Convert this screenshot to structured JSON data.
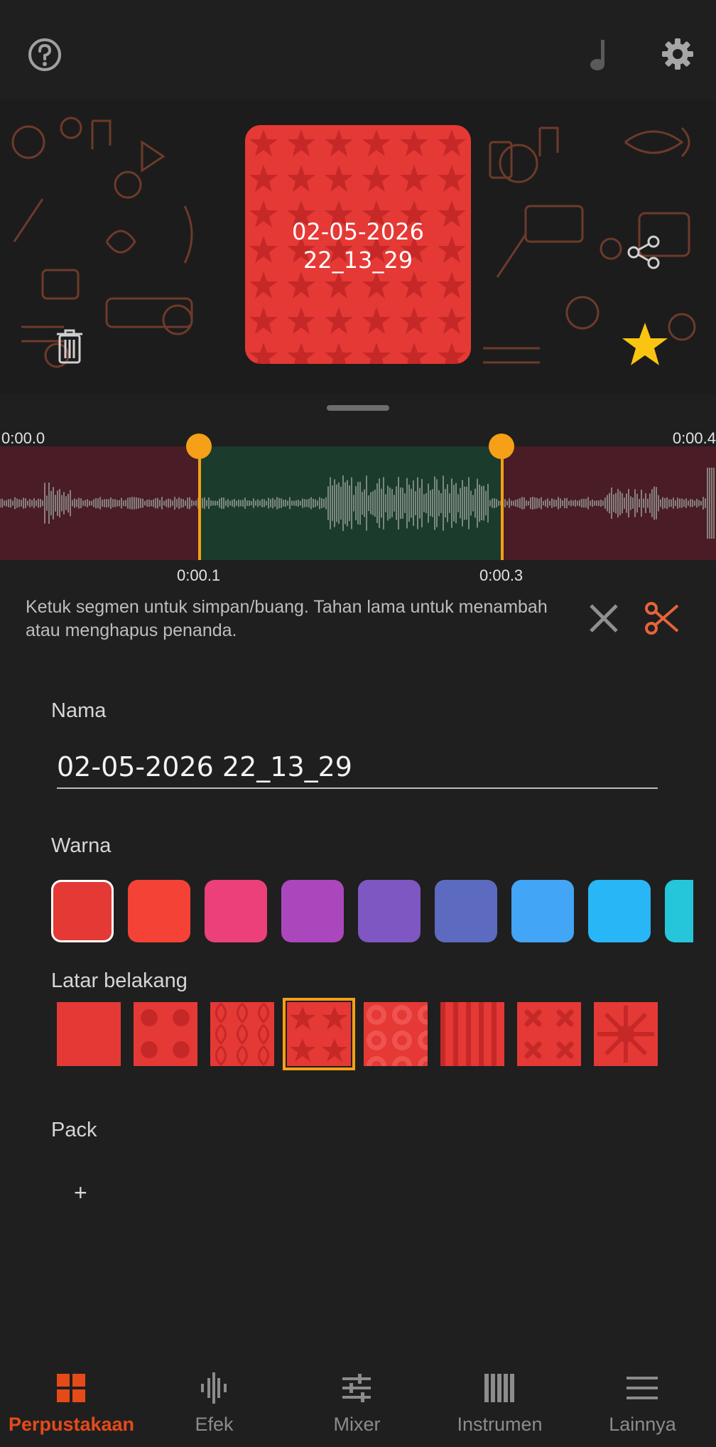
{
  "topbar": {
    "help_icon": "question-circle-icon",
    "music_icon": "music-note-icon",
    "settings_icon": "gear-icon"
  },
  "pad": {
    "title": "02-05-2026\n22_13_29",
    "color": "#e53935",
    "favorite": true
  },
  "timeline": {
    "start_time": "0:00.0",
    "end_time": "0:00.4",
    "marker_left_time": "0:00.1",
    "marker_right_time": "0:00.3",
    "segment_colors": {
      "discard": "#4a1c25",
      "keep": "#1b3b2c",
      "marker": "#f5a016"
    }
  },
  "hint": "Ketuk segmen untuk simpan/buang. Tahan lama untuk menambah atau menghapus penanda.",
  "form": {
    "name_label": "Nama",
    "name_value": "02-05-2026 22_13_29",
    "color_label": "Warna",
    "colors": [
      "#e53935",
      "#f44336",
      "#ec407a",
      "#ab47bc",
      "#7e57c2",
      "#5c6bc0",
      "#42a5f5",
      "#29b6f6",
      "#26c6da"
    ],
    "selected_color_index": 0,
    "background_label": "Latar belakang",
    "patterns": [
      "solid",
      "dots",
      "tiles",
      "stars",
      "circles",
      "stripes",
      "crosses",
      "flower"
    ],
    "selected_pattern_index": 3,
    "pack_label": "Pack",
    "pack_add": "+"
  },
  "nav": {
    "items": [
      {
        "label": "Perpustakaan",
        "icon": "grid-icon",
        "active": true
      },
      {
        "label": "Efek",
        "icon": "waveform-icon",
        "active": false
      },
      {
        "label": "Mixer",
        "icon": "sliders-icon",
        "active": false
      },
      {
        "label": "Instrumen",
        "icon": "piano-icon",
        "active": false
      },
      {
        "label": "Lainnya",
        "icon": "menu-icon",
        "active": false
      }
    ],
    "active_color": "#e64a19",
    "inactive_color": "#8c8c8c"
  }
}
